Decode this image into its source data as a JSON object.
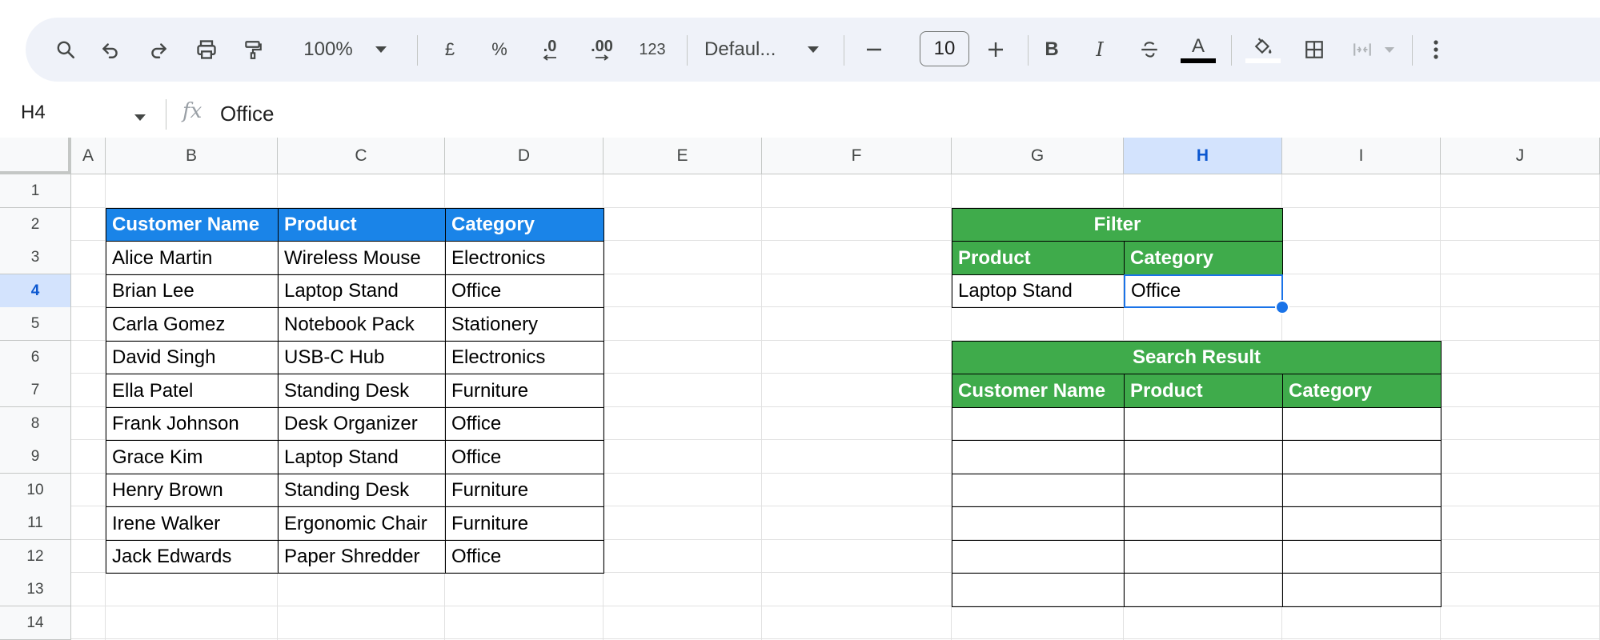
{
  "toolbar": {
    "zoom": "100%",
    "currency": "£",
    "percent": "%",
    "decrease_decimal": ".0",
    "increase_decimal": ".00",
    "number_format": "123",
    "font": "Defaul...",
    "font_size": "10",
    "minus": "−",
    "plus": "+",
    "bold": "B",
    "italic": "I",
    "text_color_letter": "A"
  },
  "formula_bar": {
    "cell_ref": "H4",
    "fx": "fx",
    "value": "Office"
  },
  "columns": [
    "A",
    "B",
    "C",
    "D",
    "E",
    "F",
    "G",
    "H",
    "I",
    "J"
  ],
  "active_column": "H",
  "rows": [
    "1",
    "2",
    "3",
    "4",
    "5",
    "6",
    "7",
    "8",
    "9",
    "10",
    "11",
    "12",
    "13",
    "14"
  ],
  "active_row": "4",
  "data_table": {
    "headers": [
      "Customer Name",
      "Product",
      "Category"
    ],
    "rows": [
      [
        "Alice Martin",
        "Wireless Mouse",
        "Electronics"
      ],
      [
        "Brian Lee",
        "Laptop Stand",
        "Office"
      ],
      [
        "Carla Gomez",
        "Notebook Pack",
        "Stationery"
      ],
      [
        "David Singh",
        "USB-C Hub",
        "Electronics"
      ],
      [
        "Ella Patel",
        "Standing Desk",
        "Furniture"
      ],
      [
        "Frank Johnson",
        "Desk Organizer",
        "Office"
      ],
      [
        "Grace Kim",
        "Laptop Stand",
        "Office"
      ],
      [
        "Henry Brown",
        "Standing Desk",
        "Furniture"
      ],
      [
        "Irene Walker",
        "Ergonomic Chair",
        "Furniture"
      ],
      [
        "Jack Edwards",
        "Paper Shredder",
        "Office"
      ]
    ]
  },
  "filter": {
    "title": "Filter",
    "headers": [
      "Product",
      "Category"
    ],
    "values": [
      "Laptop Stand",
      "Office"
    ]
  },
  "search_result": {
    "title": "Search Result",
    "headers": [
      "Customer Name",
      "Product",
      "Category"
    ],
    "rows": [
      [
        "",
        "",
        ""
      ],
      [
        "",
        "",
        ""
      ],
      [
        "",
        "",
        ""
      ],
      [
        "",
        "",
        ""
      ],
      [
        "",
        "",
        ""
      ],
      [
        "",
        "",
        ""
      ]
    ]
  },
  "colors": {
    "blue_header": "#1a84e8",
    "green_header": "#3fab4b",
    "selection": "#1a73e8"
  }
}
